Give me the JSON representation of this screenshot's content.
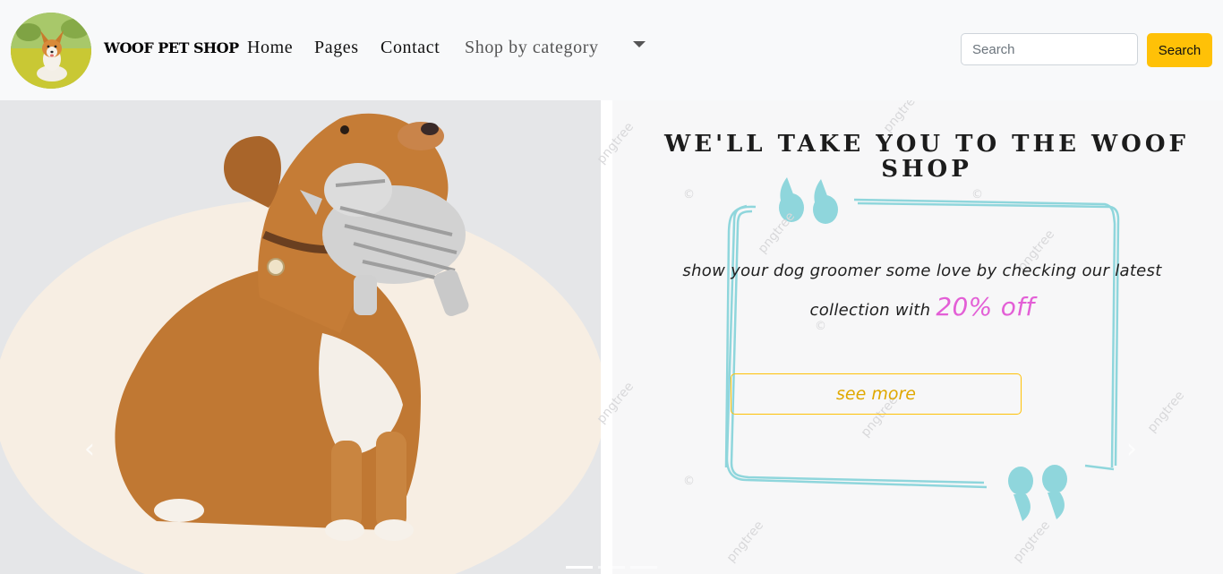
{
  "navbar": {
    "brand": "WOOF PET SHOP",
    "links": [
      "Home",
      "Pages",
      "Contact",
      "Shop by category"
    ],
    "search": {
      "placeholder": "Search",
      "value": "",
      "button_label": "Search"
    }
  },
  "carousel": {
    "headline": "We'll take you to the woof shop",
    "promo_text": "show your dog groomer some love by checking our latest collection with",
    "discount": "20% off",
    "cta_label": "see more",
    "watermark": "pngtree",
    "prev_symbol": "‹",
    "next_symbol": "›",
    "indicator_count": 3,
    "active_indicator": 0
  },
  "colors": {
    "accent": "#ffc107",
    "discount": "#e35fd6",
    "quote_frame": "#8fd6dc",
    "navbar_bg": "#f8f9fa"
  },
  "icons": {
    "logo": "corgi-logo",
    "caret": "caret-down-icon",
    "prev": "chevron-left-icon",
    "next": "chevron-right-icon",
    "quotes": "quote-marks-icon"
  }
}
